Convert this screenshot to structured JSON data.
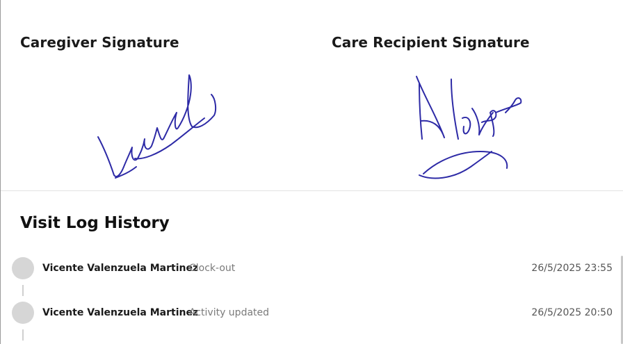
{
  "signatures": {
    "caregiver": {
      "title": "Caregiver Signature",
      "ink_color": "#2d2aa6"
    },
    "recipient": {
      "title": "Care Recipient Signature",
      "ink_color": "#2d2aa6"
    }
  },
  "visit_log": {
    "title": "Visit Log History",
    "entries": [
      {
        "name": "Vicente Valenzuela Martinez",
        "action": "Clock-out",
        "timestamp": "26/5/2025 23:55"
      },
      {
        "name": "Vicente Valenzuela Martinez",
        "action": "Activity updated",
        "timestamp": "26/5/2025 20:50"
      }
    ]
  },
  "colors": {
    "avatar_placeholder": "#d6d6d6",
    "timeline_line": "#d0d0d0",
    "divider": "#e2e2e2"
  }
}
